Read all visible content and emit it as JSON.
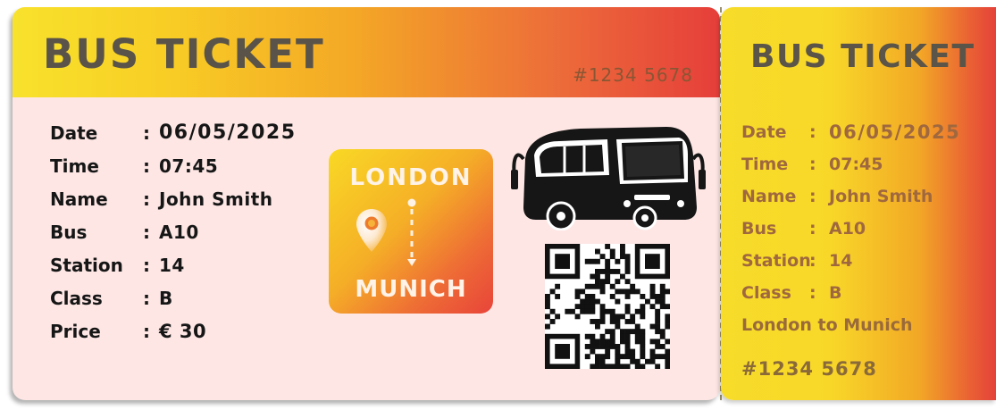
{
  "ticket": {
    "title": "BUS TICKET",
    "number": "#1234 5678",
    "fields": [
      {
        "label": "Date",
        "sep": ":",
        "value": "06/05/2025"
      },
      {
        "label": "Time",
        "sep": ":",
        "value": "07:45"
      },
      {
        "label": "Name",
        "sep": ":",
        "value": "John Smith"
      },
      {
        "label": "Bus",
        "sep": ":",
        "value": "A10"
      },
      {
        "label": "Station",
        "sep": ":",
        "value": "14"
      },
      {
        "label": "Class",
        "sep": ":",
        "value": "B"
      },
      {
        "label": "Price",
        "sep": ":",
        "value": "€ 30"
      }
    ],
    "route": {
      "from": "LONDON",
      "to": "MUNICH"
    },
    "icons": {
      "bus": "bus-icon",
      "pin": "location-pin-icon",
      "qr": "qr-code"
    }
  },
  "stub": {
    "title": "BUS TICKET",
    "fields": [
      {
        "label": "Date",
        "sep": ":",
        "value": "06/05/2025"
      },
      {
        "label": "Time",
        "sep": ":",
        "value": "07:45"
      },
      {
        "label": "Name",
        "sep": ":",
        "value": "John Smith"
      },
      {
        "label": "Bus",
        "sep": ":",
        "value": "A10"
      },
      {
        "label": "Station",
        "sep": ":",
        "value": "14"
      },
      {
        "label": "Class",
        "sep": ":",
        "value": "B"
      }
    ],
    "route_text": "London to Munich",
    "number": "#1234 5678"
  },
  "colors": {
    "gradient_start": "#f8e22c",
    "gradient_mid": "#f4a826",
    "gradient_end": "#e63e3a",
    "ticket_body": "#fde6e4",
    "title_text": "#59534a"
  }
}
